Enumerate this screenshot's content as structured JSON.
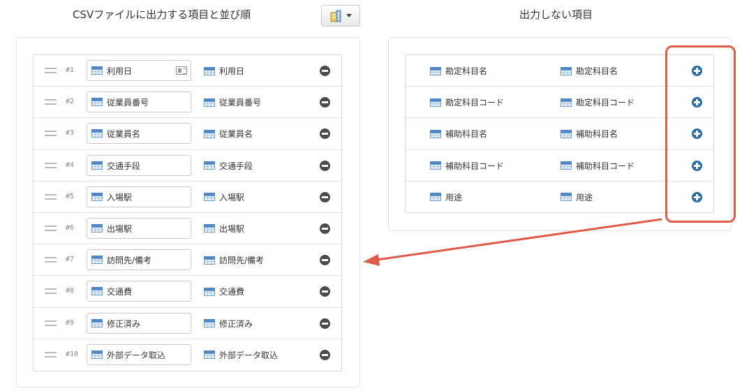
{
  "left_title": "CSVファイルに出力する項目と並び順",
  "right_title": "出力しない項目",
  "toolbar": {
    "building_icon": "building-icon",
    "dropdown_icon": "caret-down-icon"
  },
  "output_rows": [
    {
      "num": "#1",
      "field": "利用日",
      "output": "利用日",
      "has_card": true
    },
    {
      "num": "#2",
      "field": "従業員番号",
      "output": "従業員番号"
    },
    {
      "num": "#3",
      "field": "従業員名",
      "output": "従業員名"
    },
    {
      "num": "#4",
      "field": "交通手段",
      "output": "交通手段"
    },
    {
      "num": "#5",
      "field": "入場駅",
      "output": "入場駅"
    },
    {
      "num": "#6",
      "field": "出場駅",
      "output": "出場駅"
    },
    {
      "num": "#7",
      "field": "訪問先/備考",
      "output": "訪問先/備考"
    },
    {
      "num": "#8",
      "field": "交通費",
      "output": "交通費"
    },
    {
      "num": "#9",
      "field": "修正済み",
      "output": "修正済み"
    },
    {
      "num": "#10",
      "field": "外部データ取込",
      "output": "外部データ取込"
    }
  ],
  "excluded_rows": [
    {
      "name": "勘定科目名",
      "output": "勘定科目名"
    },
    {
      "name": "勘定科目コード",
      "output": "勘定科目コード"
    },
    {
      "name": "補助科目名",
      "output": "補助科目名"
    },
    {
      "name": "補助科目コード",
      "output": "補助科目コード"
    },
    {
      "name": "用途",
      "output": "用途"
    }
  ],
  "colors": {
    "accent_blue": "#2d6ca3",
    "highlight_red": "#e05a4a",
    "remove_gray": "#4a4a4a"
  }
}
